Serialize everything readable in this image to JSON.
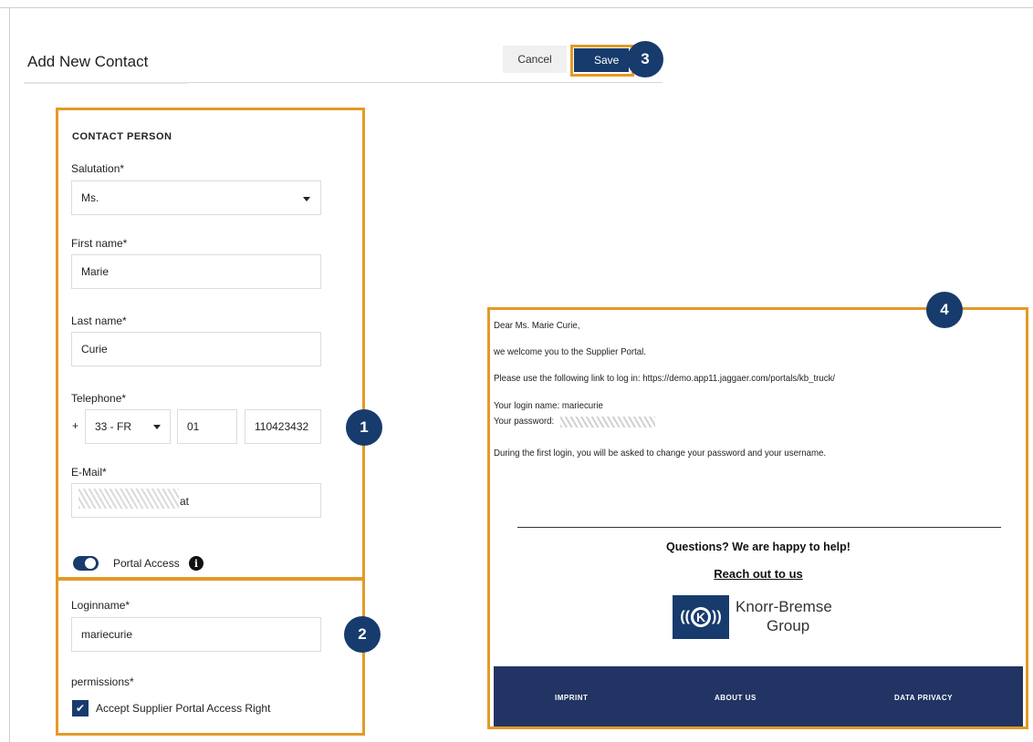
{
  "header": {
    "title": "Add New Contact",
    "cancel_label": "Cancel",
    "save_label": "Save"
  },
  "badges": [
    "1",
    "2",
    "3",
    "4"
  ],
  "contact_person": {
    "section_title": "CONTACT PERSON",
    "salutation": {
      "label": "Salutation*",
      "value": "Ms."
    },
    "first_name": {
      "label": "First name*",
      "value": "Marie"
    },
    "last_name": {
      "label": "Last name*",
      "value": "Curie"
    },
    "telephone": {
      "label": "Telephone*",
      "prefix": "+",
      "country_code": "33 - FR",
      "area_code": "01",
      "number": "110423432⁠"
    },
    "email": {
      "label": "E-Mail*",
      "visible_suffix": "at"
    },
    "portal_access": {
      "label": "Portal Access",
      "enabled": true,
      "info_icon": "info-icon"
    }
  },
  "login": {
    "loginname": {
      "label": "Loginname*",
      "value": "mariecurie"
    },
    "permissions": {
      "label": "permissions*",
      "checkbox_label": "Accept Supplier Portal Access Right",
      "checked": true
    }
  },
  "email_preview": {
    "greeting": "Dear Ms. Marie Curie,",
    "welcome": "we welcome you to the Supplier Portal.",
    "link_line": "Please use the following link to log in: https://demo.app11.jaggaer.com/portals/kb_truck/",
    "login_name_line": "Your login name: mariecurie",
    "password_line": "Your password:",
    "first_login_note": "During the first login, you will be asked to change your password and your username.",
    "questions": "Questions? We are happy to help!",
    "reach_out": "Reach out to us",
    "logo_text_1": "Knorr-Bremse",
    "logo_text_2": "Group",
    "logo_letter": "K",
    "footer": {
      "imprint": "IMPRINT",
      "about": "ABOUT US",
      "privacy": "DATA PRIVACY"
    }
  },
  "colors": {
    "accent_orange": "#e39a27",
    "brand_navy": "#173b6c",
    "footer_navy": "#213463"
  }
}
